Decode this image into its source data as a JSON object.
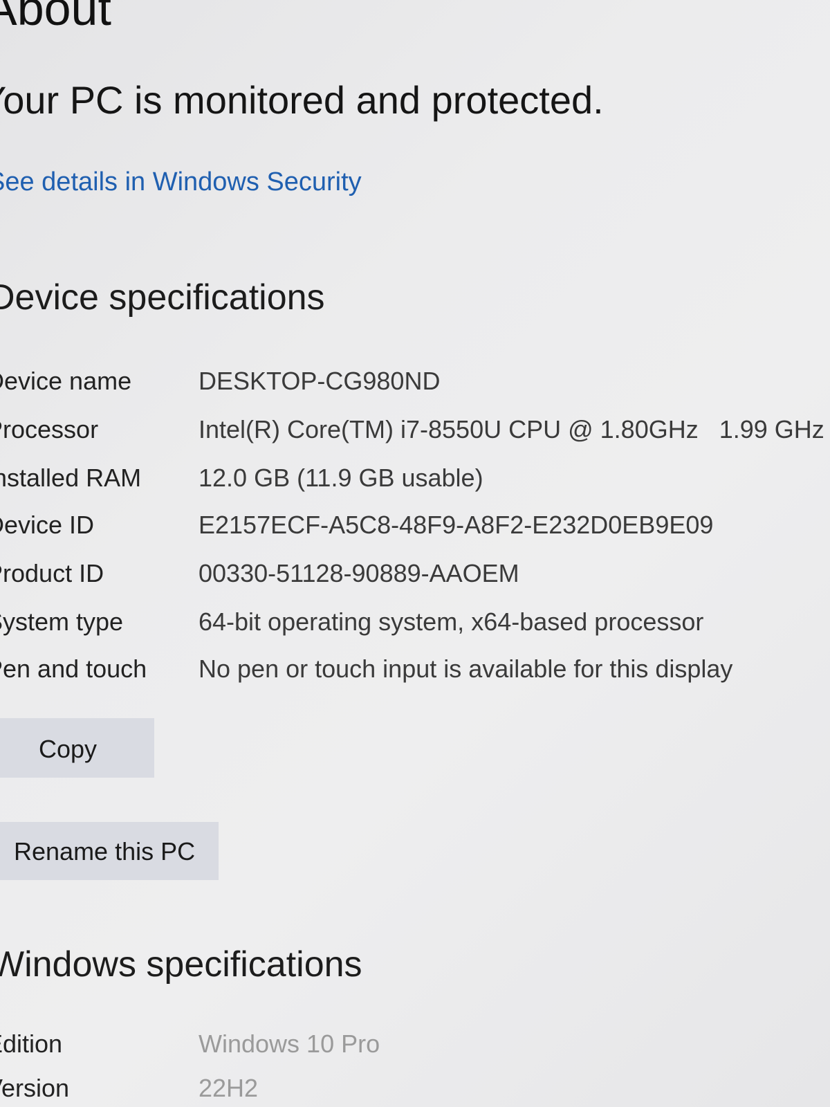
{
  "header": {
    "title": "About",
    "status": "Your PC is monitored and protected.",
    "security_link": "See details in Windows Security"
  },
  "device_specs": {
    "heading": "Device specifications",
    "rows": [
      {
        "label": "Device name",
        "value": "DESKTOP-CG980ND"
      },
      {
        "label": "Processor",
        "value": "Intel(R) Core(TM) i7-8550U CPU @ 1.80GHz   1.99 GHz"
      },
      {
        "label": "Installed RAM",
        "value": "12.0 GB (11.9 GB usable)"
      },
      {
        "label": "Device ID",
        "value": "E2157ECF-A5C8-48F9-A8F2-E232D0EB9E09"
      },
      {
        "label": "Product ID",
        "value": "00330-51128-90889-AAOEM"
      },
      {
        "label": "System type",
        "value": "64-bit operating system, x64-based processor"
      },
      {
        "label": "Pen and touch",
        "value": "No pen or touch input is available for this display"
      }
    ]
  },
  "actions": {
    "copy_label": "Copy",
    "rename_label": "Rename this PC"
  },
  "windows_specs": {
    "heading": "Windows specifications",
    "rows": [
      {
        "label": "Edition",
        "value": "Windows 10 Pro"
      },
      {
        "label": "Version",
        "value": "22H2"
      }
    ]
  },
  "colors": {
    "link": "#1f5fb0",
    "button_bg": "#d9dbe2",
    "background": "#ececed"
  }
}
